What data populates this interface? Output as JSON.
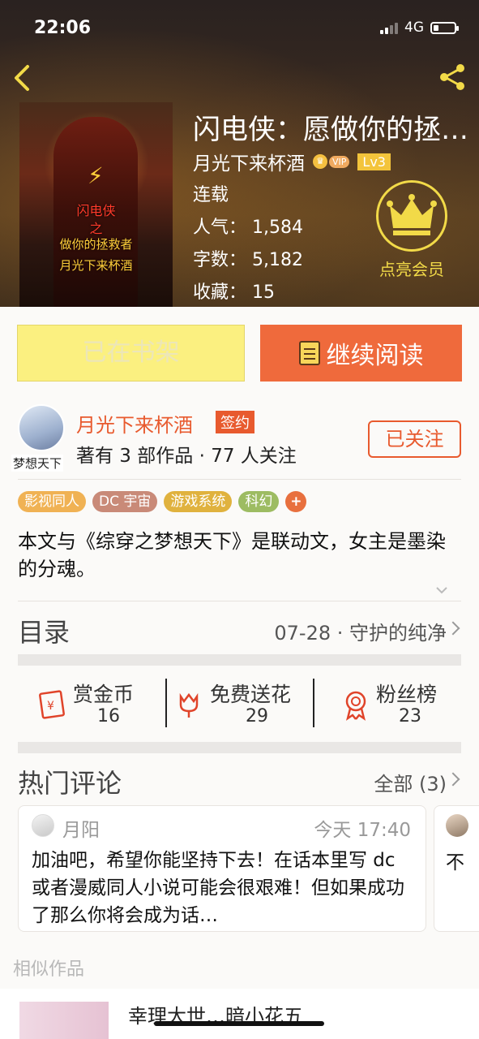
{
  "status_bar": {
    "time": "22:06",
    "network": "4G"
  },
  "book": {
    "title": "闪电侠：愿做你的拯救者",
    "author": "月光下来杯酒",
    "vip_label": "VIP",
    "level": "Lv3",
    "status": "连载",
    "popularity": "人气：  1,584",
    "word_count": "字数：  5,182",
    "favorites": "收藏：  15",
    "cover_text": {
      "line1": "闪电侠",
      "line2": "之",
      "line3": "做你的拯救者",
      "line4": "月光下来杯酒"
    }
  },
  "member_button": {
    "label": "点亮会员"
  },
  "actions": {
    "shelf_label": "已在书架",
    "read_label": "继续阅读"
  },
  "author": {
    "name": "月光下来杯酒",
    "sign_label": "签约",
    "stats": "著有 3 部作品 · 77 人关注",
    "avatar_tag": "梦想天下",
    "follow_label": "已关注"
  },
  "tags": [
    {
      "label": "影视同人",
      "color": "#f0b254"
    },
    {
      "label": "DC 宇宙",
      "color": "#c98a78"
    },
    {
      "label": "游戏系统",
      "color": "#e0b23e"
    },
    {
      "label": "科幻",
      "color": "#9dbc62"
    },
    {
      "label": "+",
      "color": "#e8703e"
    }
  ],
  "description": "本文与《综穿之梦想天下》是联动文，女主是墨染的分魂。",
  "toc": {
    "title": "目录",
    "latest": "07-28 · 守护的纯净"
  },
  "stats": {
    "coins": {
      "label": "赏金币",
      "value": "16"
    },
    "flowers": {
      "label": "免费送花",
      "value": "29"
    },
    "fans": {
      "label": "粉丝榜",
      "value": "23"
    }
  },
  "comments_section": {
    "title": "热门评论",
    "all_label": "全部 (3)",
    "comments": [
      {
        "user": "月阳",
        "time": "今天 17:40",
        "text": "加油吧，希望你能坚持下去！在话本里写 dc 或者漫威同人小说可能会很艰难！但如果成功了那么你将会成为话…"
      },
      {
        "text": "不"
      }
    ]
  },
  "similar": {
    "title": "相似作品",
    "first_item": "幸理大世…暗小花五"
  },
  "colors": {
    "accent": "#ef6a3c",
    "shelf_bg": "#fbf080",
    "member_gold": "#f2da48"
  }
}
